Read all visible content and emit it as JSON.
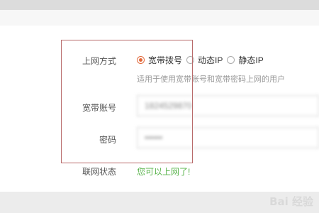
{
  "form": {
    "mode_label": "上网方式",
    "modes": [
      {
        "label": "宽带拨号",
        "checked": true
      },
      {
        "label": "动态IP",
        "checked": false
      },
      {
        "label": "静态IP",
        "checked": false
      }
    ],
    "hint": "适用于使用宽带账号和宽带密码上网的用户",
    "account_label": "宽带账号",
    "account_value": "1824529870",
    "password_label": "密码",
    "password_value": "••••••",
    "status_label": "联网状态",
    "status_text": "您可以上网了!"
  },
  "colors": {
    "accent": "#e2683a",
    "status_ok": "#58b34a",
    "highlight_box": "#b86a6a"
  },
  "watermark": "Bai 经验"
}
